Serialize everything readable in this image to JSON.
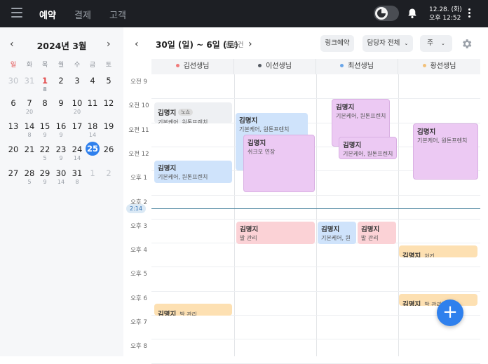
{
  "topbar": {
    "nav": [
      "예약",
      "결제",
      "고객"
    ],
    "clock_date": "12.28. (화)",
    "clock_time": "오후 12:52"
  },
  "calendar": {
    "title": "2024년 3월",
    "dows": [
      "일",
      "화",
      "목",
      "월",
      "수",
      "금",
      "토"
    ],
    "weeks": [
      [
        {
          "n": "30",
          "muted": true
        },
        {
          "n": "31",
          "muted": true
        },
        {
          "n": "1",
          "s": "8",
          "red": true
        },
        {
          "n": "2"
        },
        {
          "n": "3"
        },
        {
          "n": "4"
        },
        {
          "n": "5"
        }
      ],
      [
        {
          "n": "6"
        },
        {
          "n": "7",
          "s": "20"
        },
        {
          "n": "8"
        },
        {
          "n": "9"
        },
        {
          "n": "10",
          "s": "20"
        },
        {
          "n": "11"
        },
        {
          "n": "12"
        }
      ],
      [
        {
          "n": "13"
        },
        {
          "n": "14",
          "s": "8"
        },
        {
          "n": "15",
          "s": "9"
        },
        {
          "n": "16",
          "s": "9"
        },
        {
          "n": "17"
        },
        {
          "n": "18",
          "s": "14"
        },
        {
          "n": "19"
        }
      ],
      [
        {
          "n": "20"
        },
        {
          "n": "21"
        },
        {
          "n": "22",
          "s": "5"
        },
        {
          "n": "23",
          "s": "9"
        },
        {
          "n": "24",
          "s": "14"
        },
        {
          "n": "25",
          "sel": true
        },
        {
          "n": "26"
        }
      ],
      [
        {
          "n": "27"
        },
        {
          "n": "28",
          "s": "5"
        },
        {
          "n": "29",
          "s": "9"
        },
        {
          "n": "30",
          "s": "14"
        },
        {
          "n": "31",
          "s": "8"
        },
        {
          "n": "1",
          "muted": true
        },
        {
          "n": "2",
          "muted": true
        }
      ]
    ]
  },
  "week": {
    "range": "30일 (일) ~ 6일 (토)",
    "count": "총 8건",
    "link_btn": "링크예약",
    "staff_btn": "담당자 전체",
    "view_btn": "주",
    "now_label": "2:14"
  },
  "staff": [
    {
      "name": "김선생님",
      "color": "#f07a7a"
    },
    {
      "name": "이선생님",
      "color": "#555a62"
    },
    {
      "name": "최선생님",
      "color": "#6aa5e8"
    },
    {
      "name": "황선생님",
      "color": "#f2c17a"
    }
  ],
  "times": [
    "오전 9",
    "오전 10",
    "오전 11",
    "오전 12",
    "오후 1",
    "오후 2",
    "오후 3",
    "오후 4",
    "오후 5",
    "오후 6",
    "오후 7",
    "오후 8"
  ],
  "events": [
    {
      "name": "김명지",
      "tag": "노쇼",
      "desc": "기본케어, 원톤프렌치",
      "color": "gray"
    },
    {
      "name": "김명지",
      "desc": "기본케어, 원톤프렌치",
      "color": "blue"
    },
    {
      "name": "김명지",
      "desc": "발 관리",
      "color": "orange"
    },
    {
      "name": "김명지",
      "desc": "기본케어, 원톤프렌치",
      "color": "blue"
    },
    {
      "name": "김명지",
      "desc": "쉬크모 연장",
      "color": "purple"
    },
    {
      "name": "김명지",
      "desc": "발 관리",
      "color": "pink"
    },
    {
      "name": "김명지",
      "desc": "기본케어, 원톤프렌치",
      "color": "purple"
    },
    {
      "name": "김명지",
      "desc": "기본케어, 원톤프렌치",
      "color": "purple"
    },
    {
      "name": "김명지",
      "desc": "기본케어, 원",
      "color": "blue"
    },
    {
      "name": "김명지",
      "desc": "발 관리",
      "color": "pink"
    },
    {
      "name": "김명지",
      "desc": "기본케어, 원톤프렌치",
      "color": "purple"
    },
    {
      "name": "김명지",
      "desc": "처킨",
      "color": "orange"
    },
    {
      "name": "김명지",
      "desc": "발 관리",
      "color": "orange"
    }
  ]
}
